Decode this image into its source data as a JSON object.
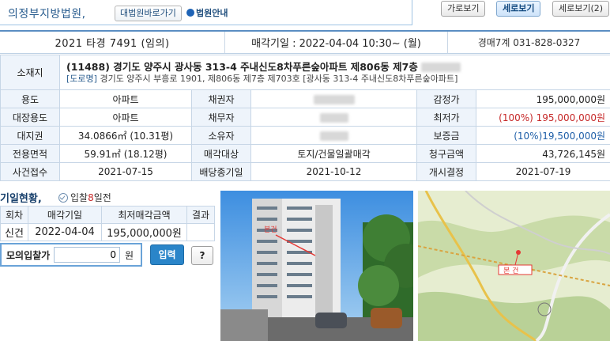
{
  "header": {
    "court_name": "의정부지방법원,",
    "court_site_button": "대법원바로가기",
    "court_guide_link": "법원안내",
    "view_buttons": [
      "가로보기",
      "세로보기",
      "세로보기(2)"
    ],
    "active_view": 1
  },
  "case": {
    "case_number": "2021 타경 7491 (임의)",
    "sale_date": "매각기일 : 2022-04-04 10:30~ (월)",
    "department": "경매7계 031-828-0327"
  },
  "property": {
    "location_label": "소재지",
    "address_main": "(11488) 경기도 양주시 광사동 313-4 주내신도8차푸른숲아파트 제806동 제7층",
    "road_tag": "[도로명]",
    "address_road": "경기도 양주시 부흥로 1901, 제806동 제7층 제703호 [광사동 313-4 주내신도8차푸른숲아파트]",
    "rows": [
      [
        {
          "label": "용도",
          "value": "아파트"
        },
        {
          "label": "채권자",
          "value": ""
        },
        {
          "label": "감정가",
          "value": "195,000,000원"
        }
      ],
      [
        {
          "label": "대장용도",
          "value": "아파트"
        },
        {
          "label": "채무자",
          "value": ""
        },
        {
          "label": "최저가",
          "value": "(100%) 195,000,000원"
        }
      ],
      [
        {
          "label": "대지권",
          "value": "34.0866㎡ (10.31평)"
        },
        {
          "label": "소유자",
          "value": ""
        },
        {
          "label": "보증금",
          "value": "(10%)19,500,000원"
        }
      ],
      [
        {
          "label": "전용면적",
          "value": "59.91㎡ (18.12평)"
        },
        {
          "label": "매각대상",
          "value": "토지/건물일괄매각"
        },
        {
          "label": "청구금액",
          "value": "43,726,145원"
        }
      ],
      [
        {
          "label": "사건접수",
          "value": "2021-07-15"
        },
        {
          "label": "배당종기일",
          "value": "2021-10-12"
        },
        {
          "label": "개시결정",
          "value": "2021-07-19"
        }
      ]
    ]
  },
  "history": {
    "title": "기일현황,",
    "subtitle_prefix": "입찰",
    "subtitle_days": "8",
    "subtitle_suffix": "일전",
    "columns": [
      "회차",
      "매각기일",
      "최저매각금액",
      "결과"
    ],
    "row": [
      "신건",
      "2022-04-04",
      "195,000,000원",
      ""
    ]
  },
  "mock_bid": {
    "label": "모의입찰가",
    "value": "0",
    "unit": "원",
    "submit": "입력",
    "help": "?"
  },
  "photo": {
    "tag": "본건"
  },
  "map": {
    "tag": "본 건"
  },
  "colors": {
    "accent": "#5b8ec2",
    "header_bg": "#eef4fb",
    "price_red": "#c62828",
    "deposit_blue": "#1f5fa8"
  }
}
